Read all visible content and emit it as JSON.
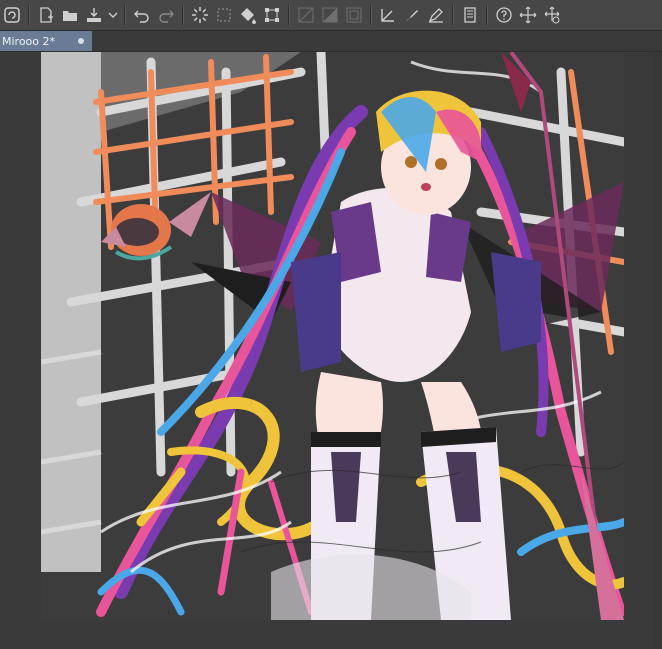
{
  "toolbar": {
    "icons": [
      "clip-studio-icon",
      "new-file-icon",
      "open-file-icon",
      "save-icon",
      "dropdown-icon",
      "undo-icon",
      "redo-icon",
      "loading-icon",
      "select-all-icon",
      "fill-icon",
      "transform-icon",
      "grid-icon",
      "gradient-icon",
      "border-icon",
      "ruler-icon",
      "pen-icon",
      "pencil-icon",
      "layer-panel-icon",
      "help-icon",
      "move-icon",
      "move-down-icon"
    ]
  },
  "document": {
    "tab_title": "Mirooo 2*"
  },
  "colors": {
    "toolbar_bg": "#474747",
    "canvas_bg": "#3a3a3a",
    "tab_active": "#6a7c95",
    "art_bg": "#3c3c3c",
    "grid_orange": "#f08c5a",
    "grid_white": "#d8d8d8",
    "hair_pink": "#e8559a",
    "hair_yellow": "#f0c43a",
    "hair_blue": "#4aa8e8",
    "hair_purple": "#7a3ab0"
  }
}
